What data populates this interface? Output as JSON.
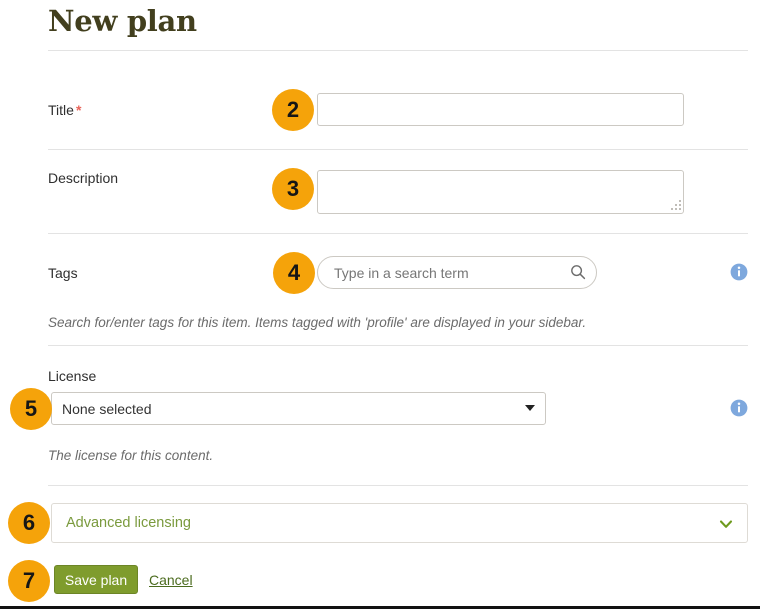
{
  "page": {
    "title": "New plan"
  },
  "fields": {
    "title": {
      "label": "Title",
      "required_marker": "*",
      "value": "",
      "placeholder": ""
    },
    "description": {
      "label": "Description",
      "value": "",
      "placeholder": ""
    },
    "tags": {
      "label": "Tags",
      "value": "",
      "placeholder": "Type in a search term",
      "help": "Search for/enter tags for this item. Items tagged with 'profile' are displayed in your sidebar.",
      "search_icon": "search-icon",
      "info_icon": "info-icon"
    },
    "license": {
      "label": "License",
      "selected": "None selected",
      "options": [
        "None selected"
      ],
      "help": "The license for this content.",
      "caret_icon": "caret-down-icon",
      "info_icon": "info-icon"
    },
    "advanced_licensing": {
      "label": "Advanced licensing",
      "chevron_icon": "chevron-down-icon",
      "expanded": false
    }
  },
  "actions": {
    "save_label": "Save plan",
    "cancel_label": "Cancel"
  },
  "callouts": [
    {
      "number": "2",
      "target": "title-input"
    },
    {
      "number": "3",
      "target": "description-input"
    },
    {
      "number": "4",
      "target": "tags-input"
    },
    {
      "number": "5",
      "target": "license-select"
    },
    {
      "number": "6",
      "target": "advanced-licensing"
    },
    {
      "number": "7",
      "target": "save-plan-button"
    }
  ],
  "colors": {
    "heading": "#423f1e",
    "badge": "#f5a30a",
    "badge_text": "#161616",
    "required_asterisk": "#e8645a",
    "save_button": "#7f9c2d",
    "link": "#4b6b1e",
    "advanced_text": "#7a9a3d",
    "info_icon": "#7ea8dd",
    "border": "#ccc9c3",
    "rule": "#e3e3e3",
    "help_text": "#6b6b6b"
  }
}
